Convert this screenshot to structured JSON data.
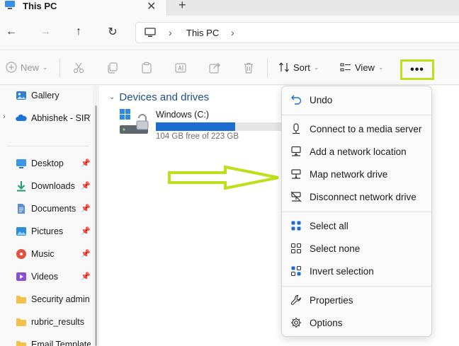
{
  "tab": {
    "title": "This PC",
    "close": "✕",
    "new_tab": "+"
  },
  "nav": {
    "back": "←",
    "forward": "→",
    "up": "↑",
    "refresh": "↻"
  },
  "address": {
    "separator": "›",
    "crumb": "This PC"
  },
  "toolbar": {
    "new_label": "New",
    "sort_label": "Sort",
    "view_label": "View",
    "more_label": "•••",
    "caret": "⌄"
  },
  "sidebar": {
    "items": [
      {
        "label": "Gallery",
        "icon": "gallery-icon"
      },
      {
        "label": "Abhishek - SIRVA",
        "icon": "onedrive-icon"
      },
      {
        "label": "Desktop",
        "icon": "desktop-icon"
      },
      {
        "label": "Downloads",
        "icon": "downloads-icon"
      },
      {
        "label": "Documents",
        "icon": "documents-icon"
      },
      {
        "label": "Pictures",
        "icon": "pictures-icon"
      },
      {
        "label": "Music",
        "icon": "music-icon"
      },
      {
        "label": "Videos",
        "icon": "videos-icon"
      },
      {
        "label": "Security admin t",
        "icon": "folder-icon"
      },
      {
        "label": "rubric_results",
        "icon": "folder-icon"
      },
      {
        "label": "Email Templates",
        "icon": "folder-icon"
      }
    ],
    "expand_chevron": "›",
    "pin": "📌"
  },
  "main": {
    "group_title": "Devices and drives",
    "group_chevron": "⌄",
    "drive": {
      "name": "Windows (C:)",
      "free_text": "104 GB free of 223 GB",
      "used_fraction": 0.534
    }
  },
  "menu": {
    "items": [
      {
        "label": "Undo",
        "icon": "undo-icon"
      },
      {
        "label": "Connect to a media server",
        "icon": "media-server-icon"
      },
      {
        "label": "Add a network location",
        "icon": "network-location-icon"
      },
      {
        "label": "Map network drive",
        "icon": "map-network-drive-icon"
      },
      {
        "label": "Disconnect network drive",
        "icon": "disconnect-network-drive-icon"
      },
      {
        "label": "Select all",
        "icon": "select-all-icon"
      },
      {
        "label": "Select none",
        "icon": "select-none-icon"
      },
      {
        "label": "Invert selection",
        "icon": "invert-selection-icon"
      },
      {
        "label": "Properties",
        "icon": "properties-icon"
      },
      {
        "label": "Options",
        "icon": "options-icon"
      }
    ]
  },
  "colors": {
    "accent": "#1c6dd0",
    "highlight": "#bfdf1a",
    "group_title": "#1f4e8c"
  }
}
